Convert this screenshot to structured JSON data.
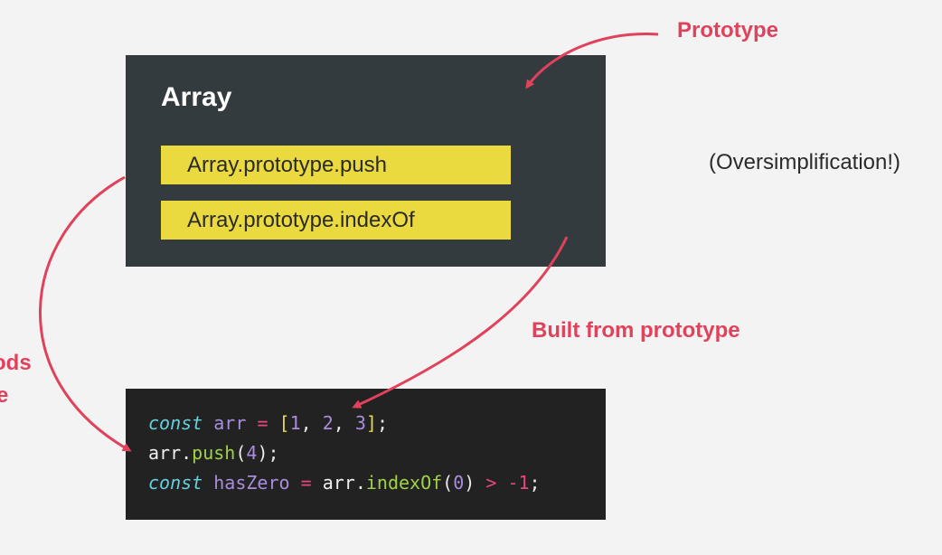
{
  "labels": {
    "prototype": "Prototype",
    "built_from_prototype": "Built from prototype",
    "cut_left_line1": "ods",
    "cut_left_line2": "e",
    "note": "(Oversimplification!)"
  },
  "array_box": {
    "title": "Array",
    "methods": [
      "Array.prototype.push",
      "Array.prototype.indexOf"
    ]
  },
  "code": {
    "line1": {
      "kw": "const",
      "name": "arr",
      "eq": "=",
      "open": "[",
      "n1": "1",
      "c1": ",",
      "n2": "2",
      "c2": ",",
      "n3": "3",
      "close": "]",
      "semi": ";"
    },
    "line2": {
      "obj": "arr",
      "dot": ".",
      "method": "push",
      "open": "(",
      "arg": "4",
      "close": ")",
      "semi": ";"
    },
    "line3": {
      "kw": "const",
      "name": "hasZero",
      "eq": "=",
      "obj": "arr",
      "dot": ".",
      "method": "indexOf",
      "open": "(",
      "arg": "0",
      "close": ")",
      "gt": ">",
      "neg": "-1",
      "semi": ";"
    }
  },
  "colors": {
    "accent_red": "#e0425c",
    "box_dark": "#333b3f",
    "pill_yellow": "#ead93f",
    "code_bg": "#222223"
  }
}
